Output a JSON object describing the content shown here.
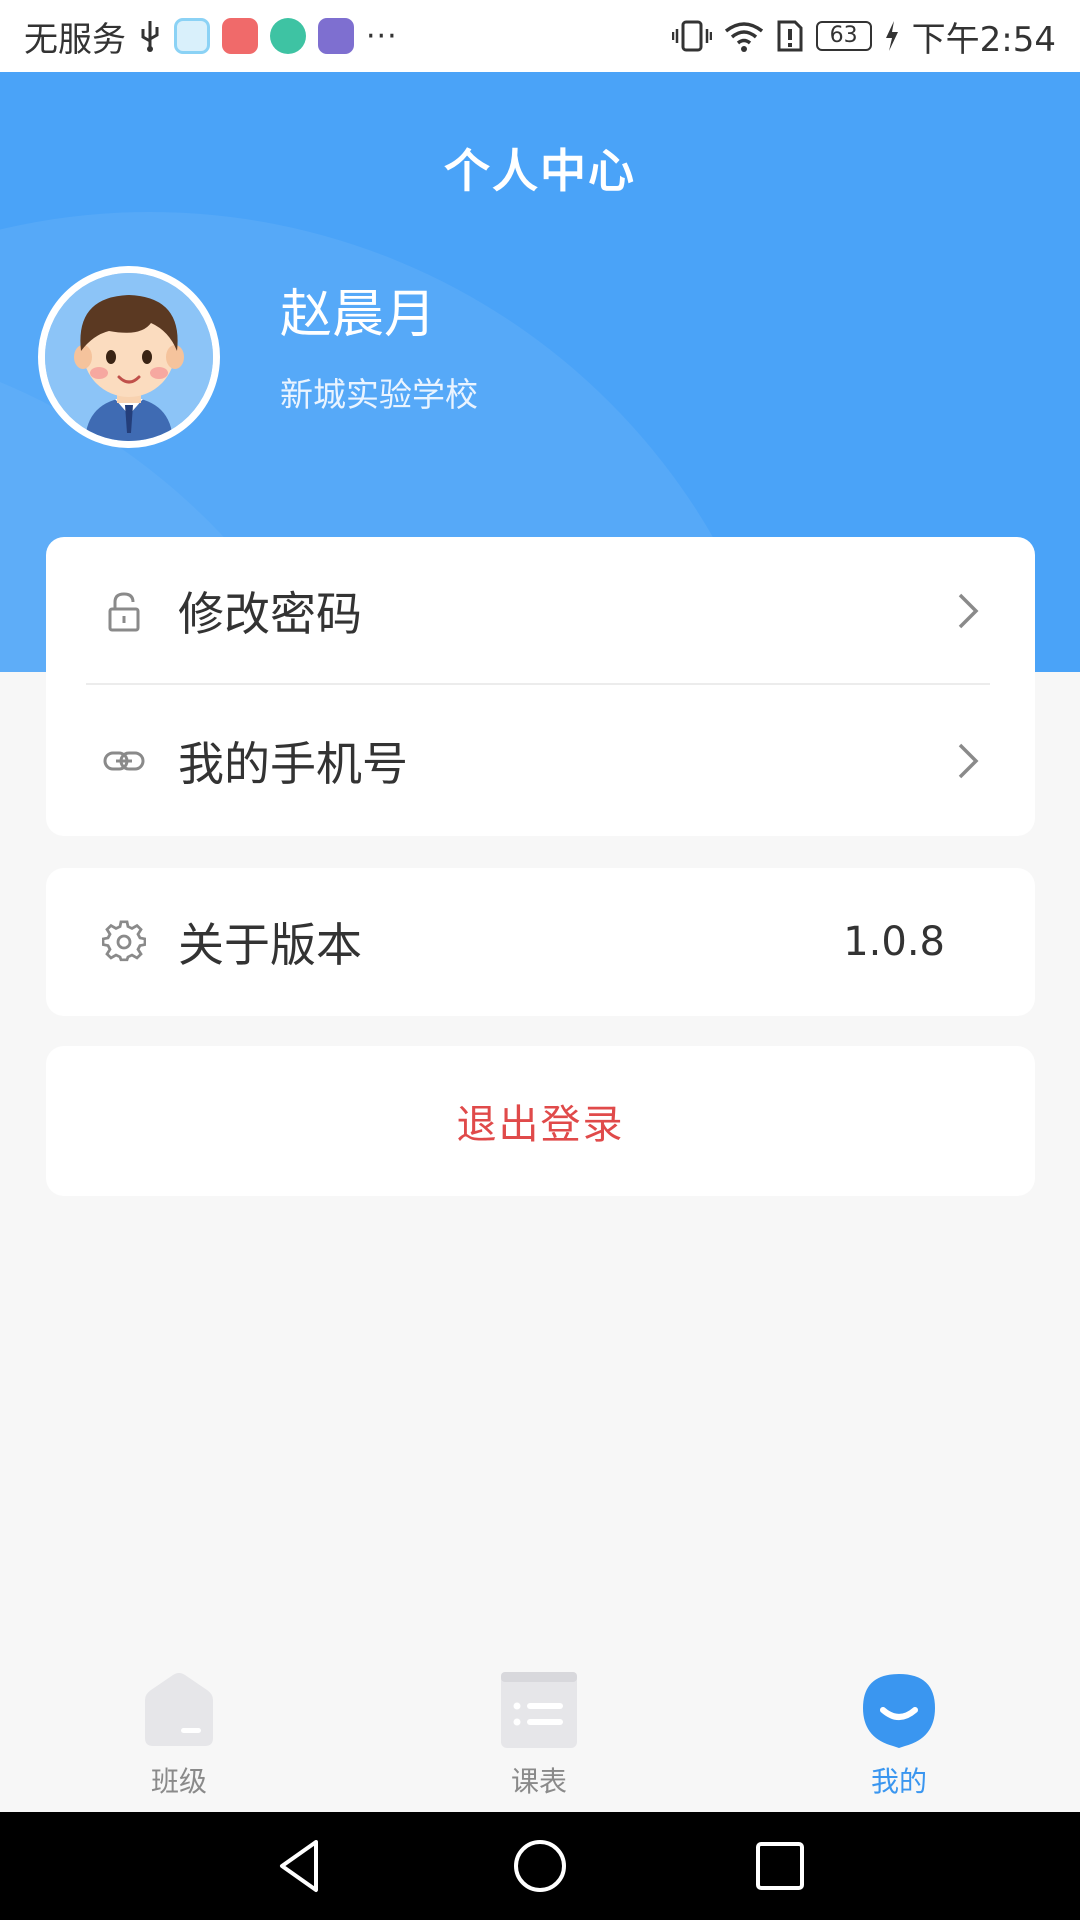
{
  "status_bar": {
    "carrier": "无服务",
    "battery": "63",
    "time": "下午2:54",
    "more": "···",
    "app_colors": [
      "#8bd2f5",
      "#f06a6a",
      "#3ec3a3",
      "#7e6fd0"
    ]
  },
  "header": {
    "title": "个人中心",
    "user_name": "赵晨月",
    "school": "新城实验学校",
    "background": "#4aa3f8"
  },
  "menu": [
    {
      "label": "修改密码",
      "icon": "lock-icon",
      "chevron": true
    },
    {
      "label": "我的手机号",
      "icon": "link-icon",
      "chevron": true
    },
    {
      "label": "关于版本",
      "icon": "gear-icon",
      "value": "1.0.8"
    }
  ],
  "logout": {
    "label": "退出登录",
    "color": "#e04a4a"
  },
  "tabs": [
    {
      "label": "班级",
      "icon": "home-icon",
      "active": false
    },
    {
      "label": "课表",
      "icon": "schedule-icon",
      "active": false
    },
    {
      "label": "我的",
      "icon": "smile-icon",
      "active": true
    }
  ],
  "nav": {
    "back": "back-icon",
    "home": "home-circle-icon",
    "recents": "recents-icon"
  }
}
